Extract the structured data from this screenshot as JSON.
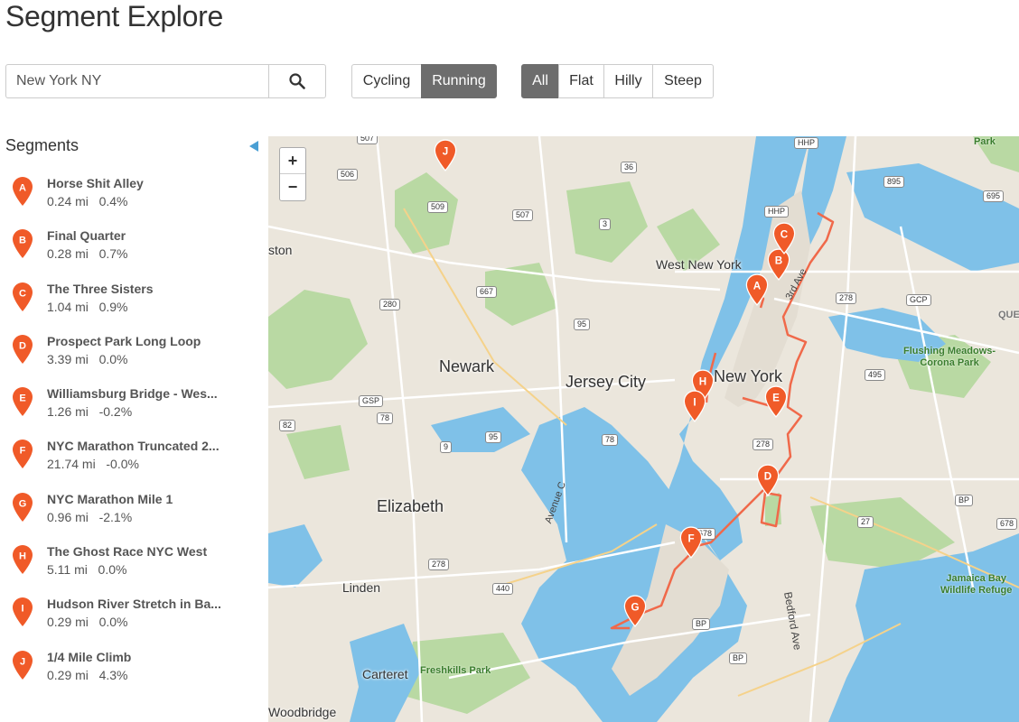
{
  "page_title": "Segment Explore",
  "search": {
    "value": "New York NY",
    "icon": "search-icon"
  },
  "sport_toggle": [
    {
      "label": "Cycling",
      "active": false
    },
    {
      "label": "Running",
      "active": true
    }
  ],
  "terrain_toggle": [
    {
      "label": "All",
      "active": true
    },
    {
      "label": "Flat",
      "active": false
    },
    {
      "label": "Hilly",
      "active": false
    },
    {
      "label": "Steep",
      "active": false
    }
  ],
  "sidebar": {
    "title": "Segments",
    "collapse_icon": "triangle-left-icon",
    "segments": [
      {
        "letter": "A",
        "name": "Horse Shit Alley",
        "distance": "0.24 mi",
        "grade": "0.4%"
      },
      {
        "letter": "B",
        "name": "Final Quarter",
        "distance": "0.28 mi",
        "grade": "0.7%"
      },
      {
        "letter": "C",
        "name": "The Three Sisters",
        "distance": "1.04 mi",
        "grade": "0.9%"
      },
      {
        "letter": "D",
        "name": "Prospect Park Long Loop",
        "distance": "3.39 mi",
        "grade": "0.0%"
      },
      {
        "letter": "E",
        "name": "Williamsburg Bridge - Wes...",
        "distance": "1.26 mi",
        "grade": "-0.2%"
      },
      {
        "letter": "F",
        "name": "NYC Marathon Truncated 2...",
        "distance": "21.74 mi",
        "grade": "-0.0%"
      },
      {
        "letter": "G",
        "name": "NYC Marathon Mile 1",
        "distance": "0.96 mi",
        "grade": "-2.1%"
      },
      {
        "letter": "H",
        "name": "The Ghost Race NYC West",
        "distance": "5.11 mi",
        "grade": "0.0%"
      },
      {
        "letter": "I",
        "name": "Hudson River Stretch in Ba...",
        "distance": "0.29 mi",
        "grade": "0.0%"
      },
      {
        "letter": "J",
        "name": "1/4 Mile Climb",
        "distance": "0.29 mi",
        "grade": "4.3%"
      }
    ]
  },
  "map": {
    "zoom_in": "+",
    "zoom_out": "−",
    "cities": [
      "Newark",
      "Jersey City",
      "New York",
      "Elizabeth",
      "Linden",
      "Carteret",
      "West New York",
      "Woodbridge",
      "ston"
    ],
    "parks": [
      "Flushing Meadows-\nCorona Park",
      "Jamaica Bay\nWildlife Refuge",
      "Freshkills Park",
      "Park",
      "QUE"
    ],
    "roads": [
      "3rd Ave",
      "Bedford Ave",
      "Avenue C"
    ],
    "shields": [
      "507",
      "506",
      "509",
      "507",
      "36",
      "3",
      "667",
      "280",
      "95",
      "GSP",
      "78",
      "82",
      "9",
      "95",
      "78",
      "278",
      "440",
      "278",
      "BP",
      "BP",
      "27",
      "278",
      "495",
      "278",
      "GCP",
      "HHP",
      "HHP",
      "895",
      "695",
      "678",
      "BP",
      "678"
    ],
    "pin_color": "#f05a28",
    "route_color": "#f0694a"
  }
}
